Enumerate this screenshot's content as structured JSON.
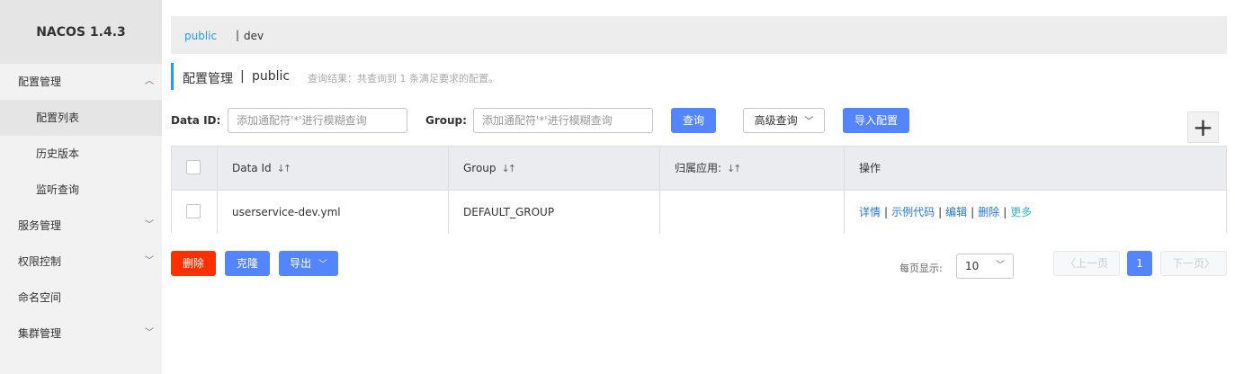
{
  "app": {
    "title": "NACOS 1.4.3"
  },
  "sidebar": {
    "items": [
      {
        "label": "配置管理",
        "chevron": "︿"
      },
      {
        "label": "配置列表"
      },
      {
        "label": "历史版本"
      },
      {
        "label": "监听查询"
      },
      {
        "label": "服务管理",
        "chevron": "﹀"
      },
      {
        "label": "权限控制",
        "chevron": "﹀"
      },
      {
        "label": "命名空间"
      },
      {
        "label": "集群管理",
        "chevron": "﹀"
      }
    ]
  },
  "namespace_bar": {
    "public": "public",
    "separator": "|",
    "dev": "dev"
  },
  "title": {
    "main": "配置管理",
    "separator": "|",
    "namespace": "public",
    "result": "查询结果：共查询到 1 条满足要求的配置。"
  },
  "search": {
    "dataid_label": "Data ID:",
    "dataid_placeholder": "添加通配符'*'进行模糊查询",
    "group_label": "Group:",
    "group_placeholder": "添加通配符'*'进行模糊查询",
    "query_button": "查询",
    "advanced_button": "高级查询",
    "import_button": "导入配置",
    "add_symbol": "+"
  },
  "table": {
    "columns": [
      "Data Id",
      "Group",
      "归属应用:",
      "操作"
    ],
    "sort_icon": "↓↑",
    "rows": [
      {
        "data_id": "userservice-dev.yml",
        "group": "DEFAULT_GROUP",
        "app": ""
      }
    ],
    "ops": {
      "detail": "详情",
      "sample": "示例代码",
      "edit": "编辑",
      "delete": "删除",
      "more": "更多",
      "sep": "|"
    }
  },
  "actions": {
    "delete": "删除",
    "clone": "克隆",
    "export": "导出"
  },
  "pagination": {
    "page_size_label": "每页显示:",
    "page_size": "10",
    "prev": "上一页",
    "next": "下一页",
    "current_page": "1"
  },
  "colors": {
    "accent": "#209bfa",
    "primary": "#5584ff",
    "danger": "#ff3000",
    "link": "#2277d6"
  }
}
